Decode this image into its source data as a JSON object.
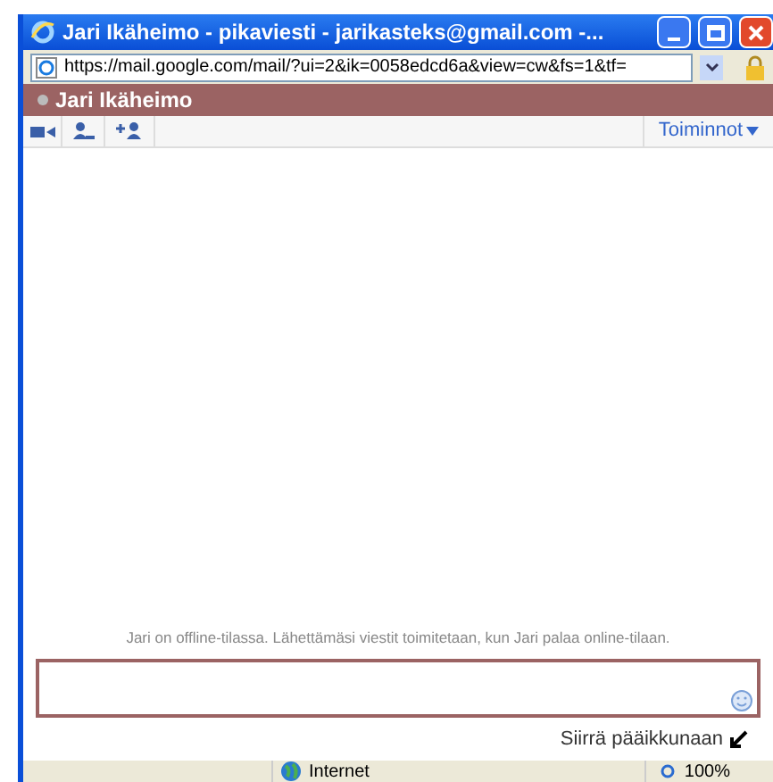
{
  "window": {
    "title": "Jari Ikäheimo - pikaviesti - jarikasteks@gmail.com -..."
  },
  "address_bar": {
    "url": "https://mail.google.com/mail/?ui=2&ik=0058edcd6a&view=cw&fs=1&tf="
  },
  "chat": {
    "contact": "Jari Ikäheimo",
    "actions_menu": "Toiminnot",
    "status_message": "Jari on offline-tilassa. Lähettämäsi viestit toimitetaan, kun Jari palaa online-tilaan.",
    "pop_in": "Siirrä pääikkunaan"
  },
  "status_bar": {
    "zone": "Internet",
    "zoom": "100%"
  }
}
